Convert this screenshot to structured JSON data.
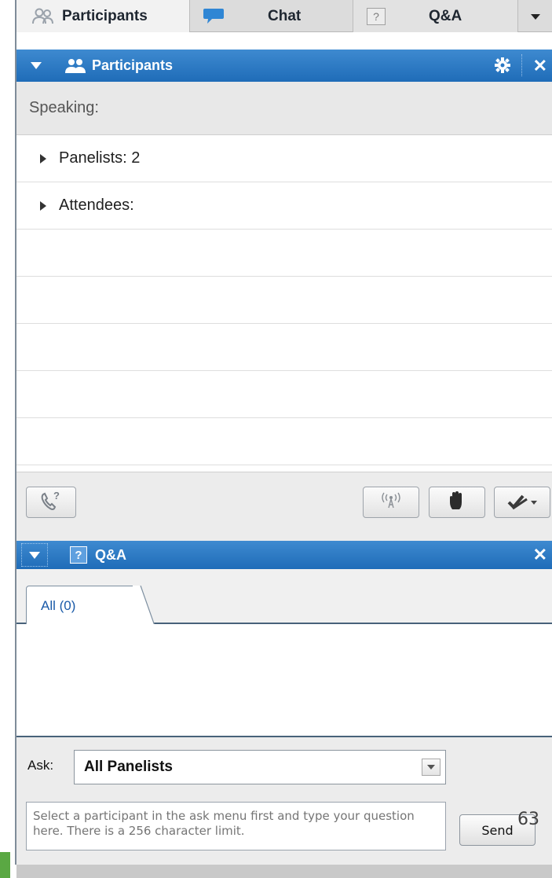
{
  "tabs": {
    "participants_label": "Participants",
    "chat_label": "Chat",
    "qa_label": "Q&A",
    "qa_icon_glyph": "?",
    "more_icon": "dropdown-triangle"
  },
  "participants_panel": {
    "title": "Participants",
    "settings_icon": "gear-icon",
    "close_glyph": "✕",
    "speaking_label": "Speaking:",
    "groups": [
      {
        "label": "Panelists: 2"
      },
      {
        "label": "Attendees:"
      }
    ],
    "toolbar": {
      "call_in_icon": "phone-question-icon",
      "broadcast_icon": "broadcast-icon",
      "raise_hand_icon": "hand-icon",
      "annotate_icon": "pen-check-icon"
    }
  },
  "qa_panel": {
    "title": "Q&A",
    "title_icon_glyph": "?",
    "close_glyph": "✕",
    "tabs": [
      {
        "label": "All (0)"
      }
    ],
    "ask_label": "Ask:",
    "ask_selected": "All Panelists",
    "question_placeholder": "Select a participant in the ask menu first and type your question here. There is a 256 character limit.",
    "send_label": "Send"
  },
  "page_number": "63",
  "colors": {
    "header_blue": "#2a78c4",
    "accent_green": "#5aa843",
    "link_blue": "#1a5aa8"
  }
}
